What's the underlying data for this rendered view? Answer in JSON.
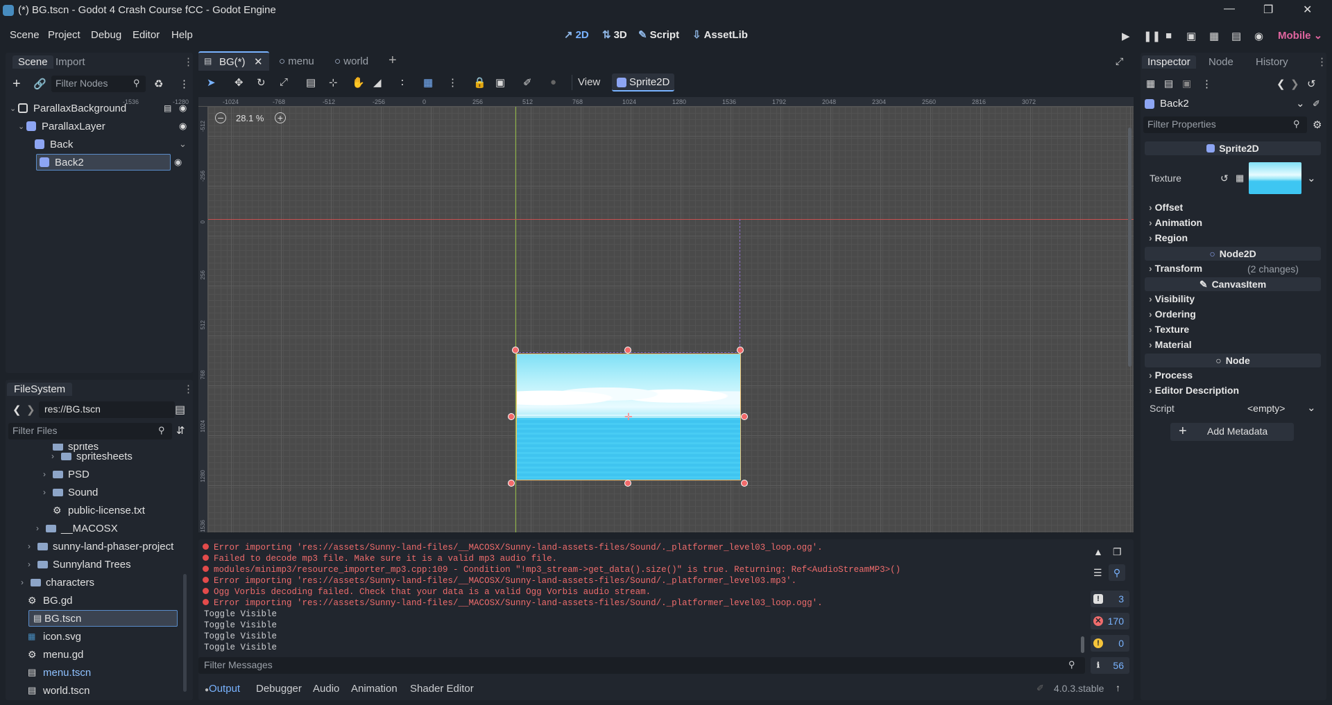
{
  "window": {
    "title": "(*) BG.tscn - Godot 4 Crash Course fCC - Godot Engine"
  },
  "menu": [
    "Scene",
    "Project",
    "Debug",
    "Editor",
    "Help"
  ],
  "workspaces": {
    "w2d": "2D",
    "w3d": "3D",
    "script": "Script",
    "assetlib": "AssetLib"
  },
  "renderer": "Mobile",
  "scene_dock": {
    "tabs": [
      "Scene",
      "Import"
    ],
    "filter_placeholder": "Filter Nodes",
    "nodes": [
      {
        "label": "ParallaxBackground"
      },
      {
        "label": "ParallaxLayer"
      },
      {
        "label": "Back"
      },
      {
        "label": "Back2"
      }
    ]
  },
  "filesystem": {
    "tab": "FileSystem",
    "path": "res://BG.tscn",
    "filter_placeholder": "Filter Files",
    "items": [
      {
        "label": "sprites"
      },
      {
        "label": "spritesheets"
      },
      {
        "label": "PSD"
      },
      {
        "label": "Sound"
      },
      {
        "label": "public-license.txt"
      },
      {
        "label": "__MACOSX"
      },
      {
        "label": "sunny-land-phaser-project"
      },
      {
        "label": "Sunnyland Trees"
      },
      {
        "label": "characters"
      },
      {
        "label": "BG.gd"
      },
      {
        "label": "BG.tscn"
      },
      {
        "label": "icon.svg"
      },
      {
        "label": "menu.gd"
      },
      {
        "label": "menu.tscn"
      },
      {
        "label": "world.tscn"
      }
    ]
  },
  "scene_tabs": [
    "BG(*)",
    "menu",
    "world"
  ],
  "viewport_toolbar": {
    "view": "View",
    "sprite2d": "Sprite2D"
  },
  "zoom": "28.1 %",
  "ruler_x": [
    "-1536",
    "-1280",
    "-1024",
    "-768",
    "-512",
    "-256",
    "0",
    "256",
    "512",
    "768",
    "1024",
    "1280",
    "1536",
    "1792",
    "2048",
    "2304",
    "2560",
    "2816",
    "3072"
  ],
  "ruler_y": [
    "-512",
    "-256",
    "0",
    "256",
    "512",
    "768",
    "1024",
    "1280",
    "1536"
  ],
  "inspector": {
    "tabs": [
      "Inspector",
      "Node",
      "History"
    ],
    "object": "Back2",
    "filter_placeholder": "Filter Properties",
    "sprite2d": "Sprite2D",
    "texture": "Texture",
    "sprite_props": [
      "Offset",
      "Animation",
      "Region"
    ],
    "node2d": "Node2D",
    "transform": "Transform",
    "transform_changes": "(2 changes)",
    "canvasitem": "CanvasItem",
    "canvas_props": [
      "Visibility",
      "Ordering",
      "Texture",
      "Material"
    ],
    "node": "Node",
    "node_props": [
      "Process",
      "Editor Description"
    ],
    "script_label": "Script",
    "script_value": "<empty>",
    "add_metadata": "Add Metadata"
  },
  "output": {
    "lines": [
      {
        "type": "error",
        "text": "Error importing 'res://assets/Sunny-land-files/__MACOSX/Sunny-land-assets-files/Sound/._platformer_level03_loop.ogg'."
      },
      {
        "type": "error",
        "text": "Failed to decode mp3 file. Make sure it is a valid mp3 audio file."
      },
      {
        "type": "error",
        "text": "modules/minimp3/resource_importer_mp3.cpp:109 - Condition \"!mp3_stream->get_data().size()\" is true. Returning: Ref<AudioStreamMP3>()"
      },
      {
        "type": "error",
        "text": "Error importing 'res://assets/Sunny-land-files/__MACOSX/Sunny-land-assets-files/Sound/._platformer_level03.mp3'."
      },
      {
        "type": "error",
        "text": "Ogg Vorbis decoding failed. Check that your data is a valid Ogg Vorbis audio stream."
      },
      {
        "type": "error",
        "text": "Error importing 'res://assets/Sunny-land-files/__MACOSX/Sunny-land-assets-files/Sound/._platformer_level03_loop.ogg'."
      },
      {
        "type": "plain",
        "text": "Toggle Visible"
      },
      {
        "type": "plain",
        "text": "Toggle Visible"
      },
      {
        "type": "plain",
        "text": "Toggle Visible"
      },
      {
        "type": "plain",
        "text": "Toggle Visible"
      }
    ],
    "filter_placeholder": "Filter Messages",
    "counts": {
      "messages": "3",
      "errors": "170",
      "warnings": "0",
      "editor": "56"
    }
  },
  "bottom_tabs": [
    "Output",
    "Debugger",
    "Audio",
    "Animation",
    "Shader Editor"
  ],
  "version": "4.0.3.stable",
  "colors": {
    "accent": "#79b3ff",
    "error": "#ef6c6c",
    "selection": "#5a8cc9",
    "renderer": "#e0659f"
  }
}
